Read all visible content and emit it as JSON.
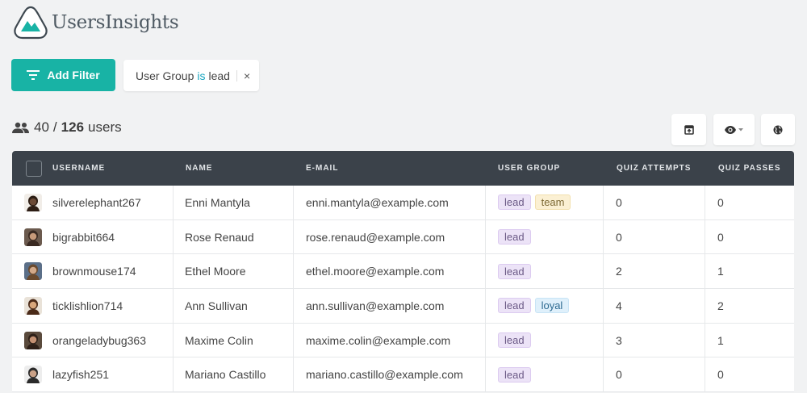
{
  "app": {
    "name": "UsersInsights",
    "accent": "#18b3a5"
  },
  "toolbar": {
    "add_filter_label": "Add Filter"
  },
  "filter": {
    "field": "User Group",
    "operator": "is",
    "value": "lead",
    "close_icon": "×"
  },
  "summary": {
    "filtered": "40",
    "separator": "/",
    "total": "126",
    "suffix": "users"
  },
  "table": {
    "headers": [
      "USERNAME",
      "NAME",
      "E-MAIL",
      "USER GROUP",
      "QUIZ ATTEMPTS",
      "QUIZ PASSES"
    ],
    "rows": [
      {
        "username": "silverelephant267",
        "name": "Enni Mantyla",
        "email": "enni.mantyla@example.com",
        "groups": [
          "lead",
          "team"
        ],
        "attempts": "0",
        "passes": "0"
      },
      {
        "username": "bigrabbit664",
        "name": "Rose Renaud",
        "email": "rose.renaud@example.com",
        "groups": [
          "lead"
        ],
        "attempts": "0",
        "passes": "0"
      },
      {
        "username": "brownmouse174",
        "name": "Ethel Moore",
        "email": "ethel.moore@example.com",
        "groups": [
          "lead"
        ],
        "attempts": "2",
        "passes": "1"
      },
      {
        "username": "ticklishlion714",
        "name": "Ann Sullivan",
        "email": "ann.sullivan@example.com",
        "groups": [
          "lead",
          "loyal"
        ],
        "attempts": "4",
        "passes": "2"
      },
      {
        "username": "orangeladybug363",
        "name": "Maxime Colin",
        "email": "maxime.colin@example.com",
        "groups": [
          "lead"
        ],
        "attempts": "3",
        "passes": "1"
      },
      {
        "username": "lazyfish251",
        "name": "Mariano Castillo",
        "email": "mariano.castillo@example.com",
        "groups": [
          "lead"
        ],
        "attempts": "0",
        "passes": "0"
      }
    ]
  },
  "tag_colors": {
    "lead": {
      "bg": "#ece3f7",
      "border": "#dccbf0",
      "text": "#6b5a86"
    },
    "team": {
      "bg": "#fbf0d3",
      "border": "#f2e0ae",
      "text": "#7d6a35"
    },
    "loyal": {
      "bg": "#dff0fb",
      "border": "#c8e4f6",
      "text": "#2d6a91"
    }
  }
}
